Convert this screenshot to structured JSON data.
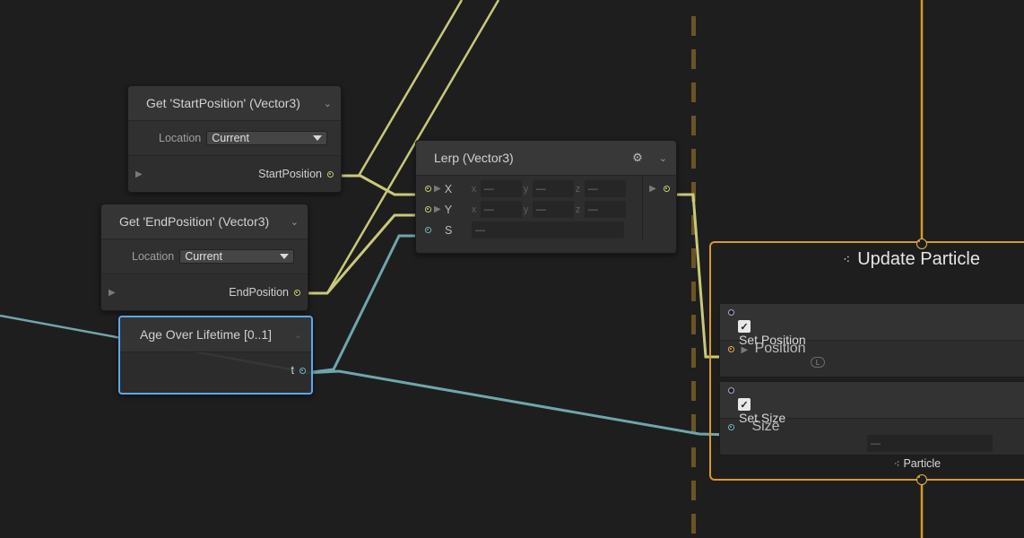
{
  "colors": {
    "background": "#1e1e1e",
    "wire_vector3": "#c9c97a",
    "wire_float": "#6fa6ac",
    "context_border": "#d69a28",
    "selection": "#5aa9f0"
  },
  "start_node": {
    "title": "Get 'StartPosition' (Vector3)",
    "location_label": "Location",
    "location_value": "Current",
    "output_label": "StartPosition"
  },
  "end_node": {
    "title": "Get 'EndPosition' (Vector3)",
    "location_label": "Location",
    "location_value": "Current",
    "output_label": "EndPosition"
  },
  "age_node": {
    "title": "Age Over Lifetime [0..1]",
    "output_label": "t"
  },
  "lerp_node": {
    "title": "Lerp (Vector3)",
    "inputs": [
      {
        "label": "X",
        "x": "x",
        "x_val": "—",
        "y": "y",
        "y_val": "—",
        "z": "z",
        "z_val": "—"
      },
      {
        "label": "Y",
        "x": "x",
        "x_val": "—",
        "y": "y",
        "y_val": "—",
        "z": "z",
        "z_val": "—"
      }
    ],
    "s_label": "S",
    "s_value": "—"
  },
  "update_context": {
    "title": "Update Particle",
    "footer": "Particle",
    "blocks": [
      {
        "title": "Set Position",
        "param": "Position",
        "badge": "L"
      },
      {
        "title": "Set Size",
        "param": "Size",
        "value": "—"
      }
    ]
  }
}
